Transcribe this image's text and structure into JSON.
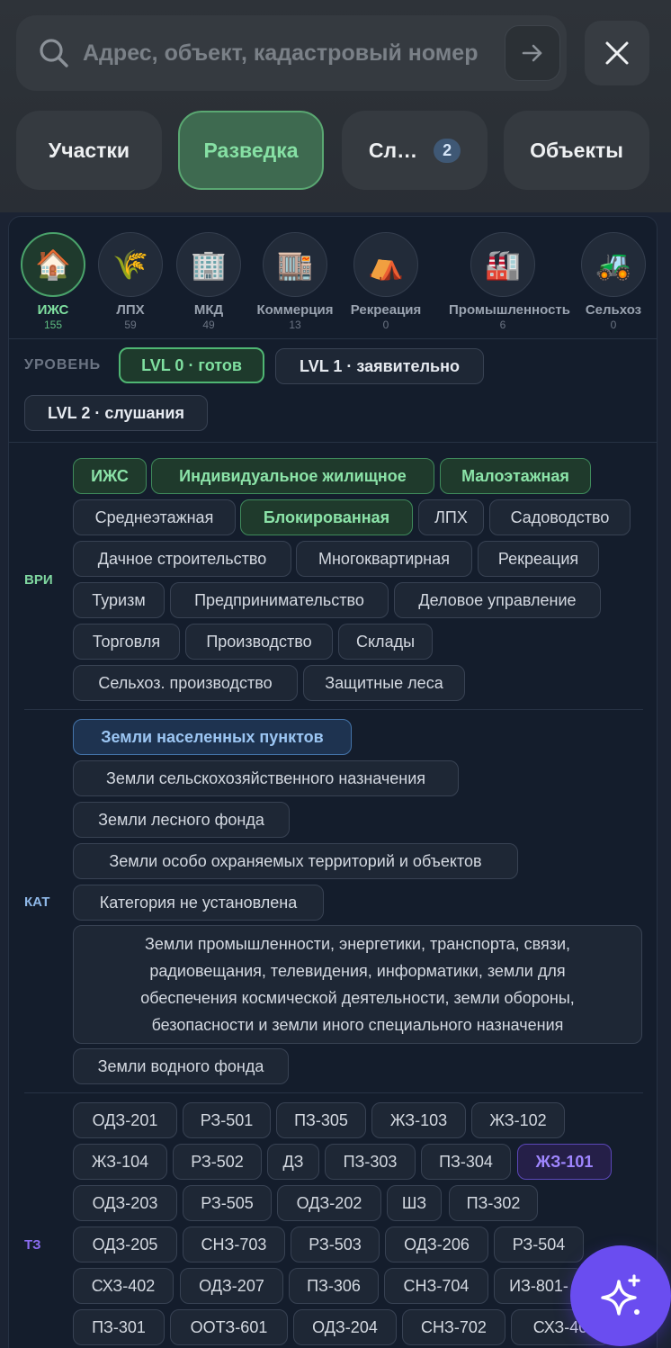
{
  "search": {
    "placeholder": "Адрес, объект, кадастровый номер"
  },
  "tabs": [
    {
      "label": "Участки"
    },
    {
      "label": "Разведка"
    },
    {
      "label": "Сл…",
      "badge": "2"
    },
    {
      "label": "Объекты"
    }
  ],
  "types": [
    {
      "label": "ИЖС",
      "count": "155",
      "icon": "🏠"
    },
    {
      "label": "ЛПХ",
      "count": "59",
      "icon": "🌾"
    },
    {
      "label": "МКД",
      "count": "49",
      "icon": "🏢"
    },
    {
      "label": "Коммерция",
      "count": "13",
      "icon": "🏬"
    },
    {
      "label": "Рекреация",
      "count": "0",
      "icon": "⛺"
    },
    {
      "label": "Промышленность",
      "count": "6",
      "icon": "🏭"
    },
    {
      "label": "Сельхоз",
      "count": "0",
      "icon": "🚜"
    }
  ],
  "level": {
    "label": "УРОВЕНЬ",
    "options": [
      "LVL 0 · готов",
      "LVL 1 · заявительно",
      "LVL 2 · слушания"
    ]
  },
  "vri": {
    "label": "ВРИ",
    "items": [
      "ИЖС",
      "Индивидуальное жилищное",
      "Малоэтажная",
      "Среднеэтажная",
      "Блокированная",
      "ЛПХ",
      "Садоводство",
      "Дачное строительство",
      "Многоквартирная",
      "Рекреация",
      "Туризм",
      "Предпринимательство",
      "Деловое управление",
      "Торговля",
      "Производство",
      "Склады",
      "Сельхоз. производство",
      "Защитные леса"
    ]
  },
  "kat": {
    "label": "КАТ",
    "items": [
      "Земли населенных пунктов",
      "Земли сельскохозяйственного назначения",
      "Земли лесного фонда",
      "Земли особо охраняемых территорий и объектов",
      "Категория не установлена",
      "Земли промышленности, энергетики, транспорта, связи, радиовещания, телевидения, информатики, земли для обеспечения космической деятельности, земли обороны, безопасности и земли иного специального назначения",
      "Земли водного фонда"
    ]
  },
  "tz": {
    "label": "ТЗ",
    "items": [
      "ОДЗ-201",
      "РЗ-501",
      "ПЗ-305",
      "ЖЗ-103",
      "ЖЗ-102",
      "ЖЗ-104",
      "РЗ-502",
      "ДЗ",
      "ПЗ-303",
      "ПЗ-304",
      "ЖЗ-101",
      "ОДЗ-203",
      "РЗ-505",
      "ОДЗ-202",
      "ШЗ",
      "ПЗ-302",
      "ОДЗ-205",
      "СНЗ-703",
      "РЗ-503",
      "ОДЗ-206",
      "РЗ-504",
      "СХЗ-402",
      "ОДЗ-207",
      "ПЗ-306",
      "СНЗ-704",
      "ИЗ-801-",
      "ПЗ-301",
      "ООТЗ-601",
      "ОДЗ-204",
      "СНЗ-702",
      "СХЗ-40"
    ]
  },
  "colors": {
    "accent_green": "#4fb673",
    "accent_blue": "#4474aa",
    "accent_purple": "#6a4df0",
    "vri_label": "#7fd7a0",
    "kat_label": "#8fb8e8",
    "tz_label": "#8a6cf0"
  },
  "icons": {
    "search": "search-icon",
    "go": "arrow-right-icon",
    "close": "close-icon",
    "fab": "sparkles-icon"
  }
}
